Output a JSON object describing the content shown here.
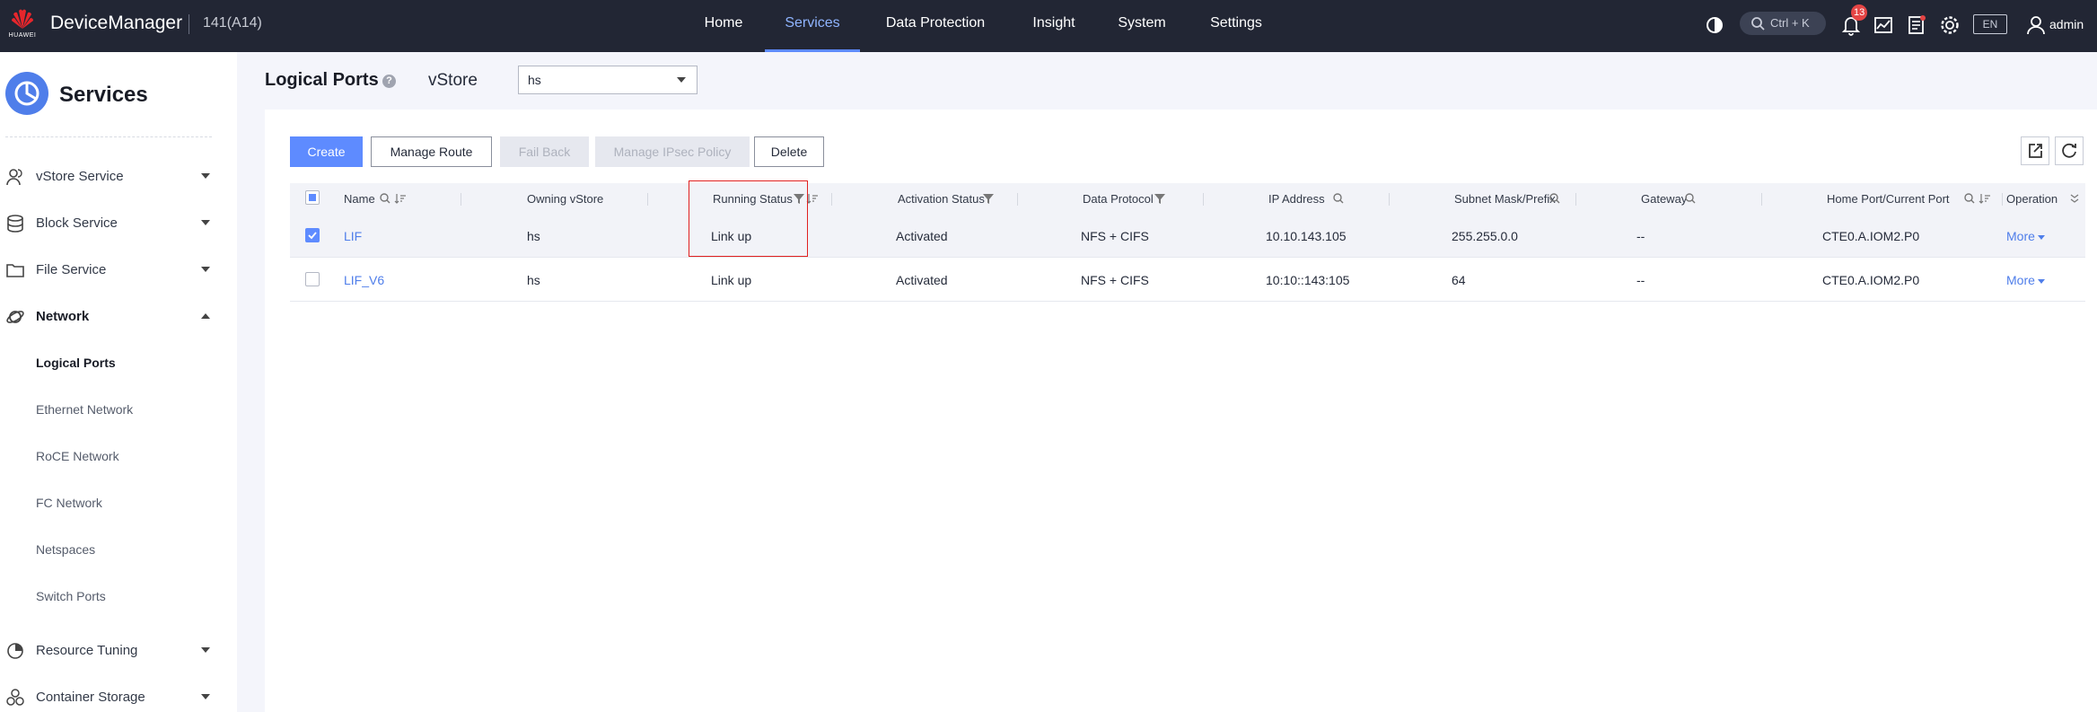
{
  "topbar": {
    "logo_text": "HUAWEI",
    "app_title": "DeviceManager",
    "device_id": "141(A14)",
    "nav": [
      {
        "label": "Home"
      },
      {
        "label": "Services"
      },
      {
        "label": "Data Protection"
      },
      {
        "label": "Insight"
      },
      {
        "label": "System"
      },
      {
        "label": "Settings"
      }
    ],
    "active_nav": "Services",
    "search_shortcut": "Ctrl + K",
    "alarm_count": "13",
    "language": "EN",
    "user": "admin",
    "accent_color": "#5e8bff",
    "background_color": "#222634"
  },
  "sidebar": {
    "title": "Services",
    "items": [
      {
        "label": "vStore Service",
        "icon": "users-icon",
        "expanded": false
      },
      {
        "label": "Block Service",
        "icon": "database-icon",
        "expanded": false
      },
      {
        "label": "File Service",
        "icon": "folder-icon",
        "expanded": false
      },
      {
        "label": "Network",
        "icon": "planet-icon",
        "expanded": true
      },
      {
        "label": "Resource Tuning",
        "icon": "tuning-icon",
        "expanded": false
      },
      {
        "label": "Container Storage",
        "icon": "container-icon",
        "expanded": false
      }
    ],
    "network_subitems": [
      {
        "label": "Logical Ports",
        "active": true
      },
      {
        "label": "Ethernet Network"
      },
      {
        "label": "RoCE Network"
      },
      {
        "label": "FC Network"
      },
      {
        "label": "Netspaces"
      },
      {
        "label": "Switch Ports"
      }
    ]
  },
  "page": {
    "title": "Logical Ports",
    "vstore_label": "vStore",
    "vstore_value": "hs"
  },
  "toolbar": {
    "create": "Create",
    "manage_route": "Manage Route",
    "fail_back": "Fail Back",
    "manage_ipsec": "Manage IPsec Policy",
    "delete": "Delete"
  },
  "table": {
    "columns": [
      "Name",
      "Owning vStore",
      "Running Status",
      "Activation Status",
      "Data Protocol",
      "IP Address",
      "Subnet Mask/Prefix",
      "Gateway",
      "Home Port/Current Port",
      "Operation"
    ],
    "rows": [
      {
        "name": "LIF",
        "vstore": "hs",
        "running": "Link up",
        "activation": "Activated",
        "protocol": "NFS + CIFS",
        "ip": "10.10.143.105",
        "subnet": "255.255.0.0",
        "gateway": "--",
        "port": "CTE0.A.IOM2.P0",
        "operation": "More",
        "selected": true
      },
      {
        "name": "LIF_V6",
        "vstore": "hs",
        "running": "Link up",
        "activation": "Activated",
        "protocol": "NFS + CIFS",
        "ip": "10:10::143:105",
        "subnet": "64",
        "gateway": "--",
        "port": "CTE0.A.IOM2.P0",
        "operation": "More",
        "selected": false
      }
    ]
  }
}
